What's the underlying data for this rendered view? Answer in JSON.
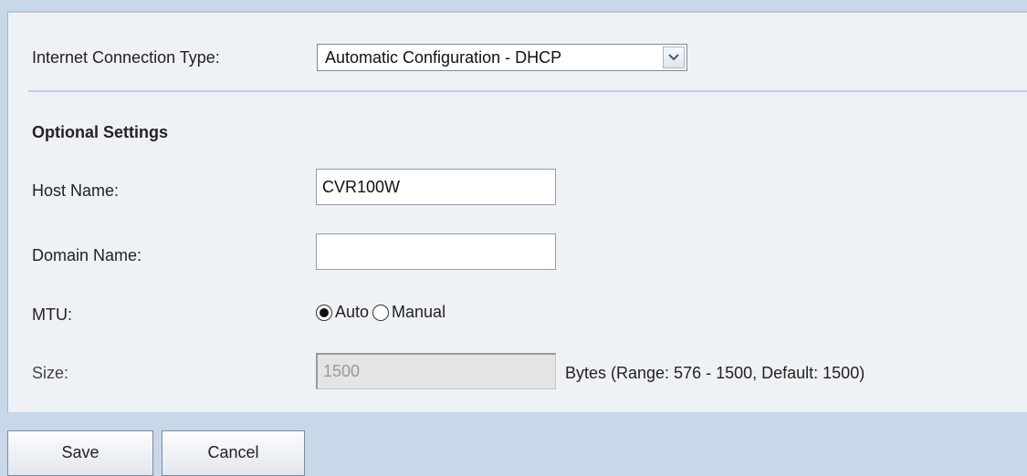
{
  "form": {
    "connection_type_label": "Internet Connection Type:",
    "connection_type_value": "Automatic Configuration - DHCP",
    "optional_heading": "Optional Settings",
    "host_name_label": "Host Name:",
    "host_name_value": "CVR100W",
    "domain_name_label": "Domain Name:",
    "domain_name_value": "",
    "mtu_label": "MTU:",
    "mtu_options": [
      "Auto",
      "Manual"
    ],
    "mtu_selected": "Auto",
    "size_label": "Size:",
    "size_value": "1500",
    "size_hint": "Bytes (Range: 576 - 1500, Default: 1500)"
  },
  "buttons": {
    "save_label": "Save",
    "cancel_label": "Cancel"
  },
  "icons": {
    "dropdown": "chevron-down-icon"
  },
  "colors": {
    "page_background": "#c9d8e8",
    "panel_background": "#eef2f5",
    "divider": "#c6c9e6"
  }
}
